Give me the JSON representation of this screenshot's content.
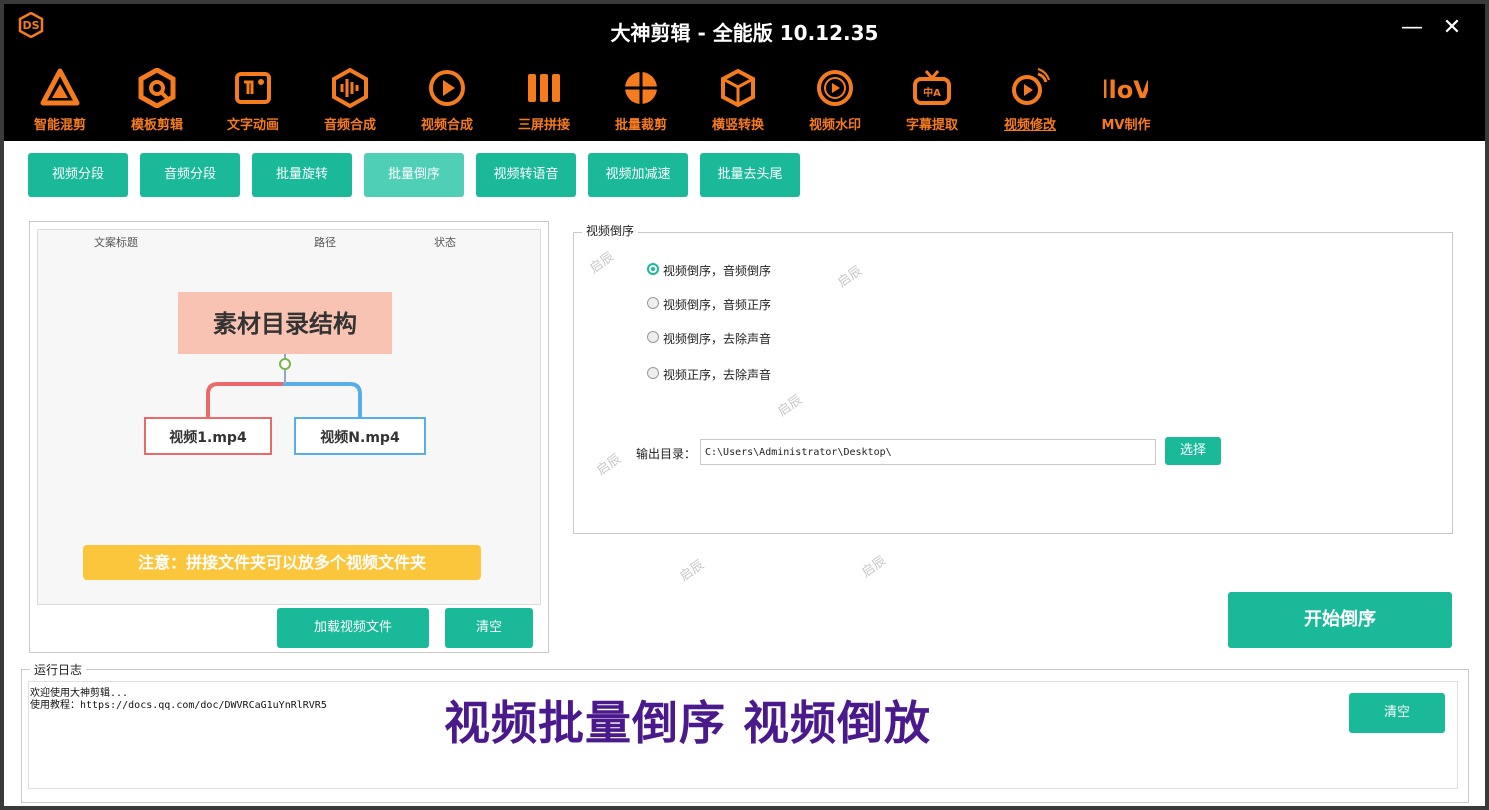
{
  "app": {
    "title": "大神剪辑 - 全能版 10.12.35",
    "minimize_glyph": "—",
    "close_glyph": "✕"
  },
  "colors": {
    "accent": "#1ab99a",
    "tool_orange": "#f57b1f",
    "overlay_purple": "#4a1a8c"
  },
  "toolbar": [
    {
      "label": "智能混剪",
      "icon": "triangle-logo-icon"
    },
    {
      "label": "模板剪辑",
      "icon": "hexagon-q-icon"
    },
    {
      "label": "文字动画",
      "icon": "text-frame-icon"
    },
    {
      "label": "音频合成",
      "icon": "audio-hexagon-icon"
    },
    {
      "label": "视频合成",
      "icon": "video-play-icon"
    },
    {
      "label": "三屏拼接",
      "icon": "three-screen-icon"
    },
    {
      "label": "批量裁剪",
      "icon": "crop-sphere-icon"
    },
    {
      "label": "横竖转换",
      "icon": "rotate-cube-icon"
    },
    {
      "label": "视频水印",
      "icon": "watermark-play-icon"
    },
    {
      "label": "字幕提取",
      "icon": "subtitle-tv-icon"
    },
    {
      "label": "视频修改",
      "icon": "video-edit-icon"
    },
    {
      "label": "MV制作",
      "icon": "mv-logo-icon"
    }
  ],
  "subtabs": [
    "视频分段",
    "音频分段",
    "批量旋转",
    "批量倒序",
    "视频转语音",
    "视频加减速",
    "批量去头尾"
  ],
  "preview": {
    "col_title": "文案标题",
    "col_path": "路径",
    "col_status": "状态",
    "diagram_title": "素材目录结构",
    "node_left": "视频1.mp4",
    "node_right": "视频N.mp4",
    "note": "注意：拼接文件夹可以放多个视频文件夹"
  },
  "left_buttons": {
    "load": "加载视频文件",
    "clear": "清空"
  },
  "reverse_group": {
    "label": "视频倒序",
    "options": [
      "视频倒序，音频倒序",
      "视频倒序，音频正序",
      "视频倒序，去除声音",
      "视频正序，去除声音"
    ],
    "selected_index": 0,
    "output_label": "输出目录：",
    "output_value": "C:\\Users\\Administrator\\Desktop\\",
    "choose_button": "选择"
  },
  "start_button": "开始倒序",
  "watermark_text": "启辰",
  "log": {
    "label": "运行日志",
    "lines": [
      "欢迎使用大神剪辑...",
      "使用教程：https://docs.qq.com/doc/DWVRCaG1uYnRlRVR5"
    ],
    "clear_button": "清空"
  },
  "overlay_caption": "视频批量倒序 视频倒放"
}
